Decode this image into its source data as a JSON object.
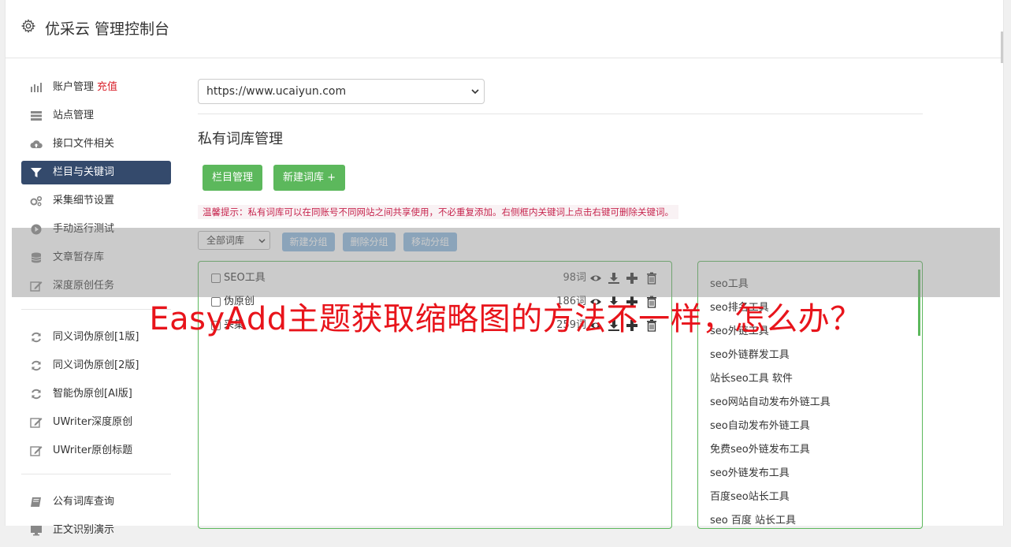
{
  "header": {
    "title": "优采云 管理控制台"
  },
  "sidebar": {
    "items": [
      {
        "label": "账户管理",
        "badge": "充值",
        "icon": "bar-chart-icon"
      },
      {
        "label": "站点管理",
        "icon": "server-icon"
      },
      {
        "label": "接口文件相关",
        "icon": "cloud-upload-icon"
      },
      {
        "label": "栏目与关键词",
        "icon": "filter-icon",
        "active": true
      },
      {
        "label": "采集细节设置",
        "icon": "gears-icon"
      },
      {
        "label": "手动运行测试",
        "icon": "play-circle-icon"
      },
      {
        "label": "文章暂存库",
        "icon": "database-icon"
      },
      {
        "label": "深度原创任务",
        "icon": "edit-icon"
      }
    ],
    "items2": [
      {
        "label": "同义词伪原创[1版]",
        "icon": "refresh-icon"
      },
      {
        "label": "同义词伪原创[2版]",
        "icon": "refresh-icon"
      },
      {
        "label": "智能伪原创[AI版]",
        "icon": "refresh-icon"
      },
      {
        "label": "UWriter深度原创",
        "icon": "edit-icon"
      },
      {
        "label": "UWriter原创标题",
        "icon": "edit-icon"
      }
    ],
    "items3": [
      {
        "label": "公有词库查询",
        "icon": "book-icon"
      },
      {
        "label": "正文识别演示",
        "icon": "monitor-icon"
      }
    ]
  },
  "main": {
    "site_select": "https://www.ucaiyun.com",
    "page_title": "私有词库管理",
    "btn_columns": "栏目管理",
    "btn_new_lib": "新建词库 +",
    "tip": "温馨提示：私有词库可以在同账号不同网站之间共享使用，不必重复添加。右侧框内关键词上点击右键可删除关键词。",
    "group_select": "全部词库",
    "btn_new_group": "新建分组",
    "btn_del_group": "删除分组",
    "btn_move_group": "移动分组",
    "libraries": [
      {
        "name": "SEO工具",
        "count": "98词"
      },
      {
        "name": "伪原创",
        "count": "186词"
      },
      {
        "name": "采集",
        "count": "259词"
      }
    ],
    "keywords": [
      "seo工具",
      "seo排名工具",
      "seo外链工具",
      "seo外链群发工具",
      "站长seo工具 软件",
      "seo网站自动发布外链工具",
      "seo自动发布外链工具",
      "免费seo外链发布工具",
      "seo外链发布工具",
      "百度seo站长工具",
      "seo 百度 站长工具"
    ]
  },
  "overlay": {
    "headline": "EasyAdd主题获取缩略图的方法不一样，怎么办？"
  },
  "colors": {
    "accent_green": "#5cb85c",
    "active_nav": "#344a6c",
    "badge_red": "#d9232d",
    "overlay_red": "#e8141b"
  }
}
